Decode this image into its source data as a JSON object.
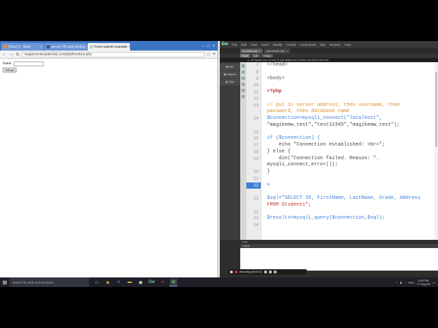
{
  "chrome": {
    "tabs": [
      {
        "label": "(New) 4 - Mem",
        "active": false
      },
      {
        "label": "server FB web hosting",
        "active": false
      },
      {
        "label": "Form submit example",
        "active": true
      }
    ],
    "address": "magicmonkeytutorials.com/php/formtest.php",
    "form": {
      "name_label": "Name:",
      "submit_label": "Submit"
    }
  },
  "dreamweaver": {
    "logo": "Dw",
    "menu": [
      "File",
      "Edit",
      "View",
      "Insert",
      "Modify",
      "Format",
      "Commands",
      "Site",
      "Window",
      "Help"
    ],
    "doc_tabs": [
      {
        "label": "formtest.php",
        "active": true
      },
      {
        "label": "phonebook.php",
        "active": false
      }
    ],
    "view_buttons": [
      {
        "label": "Code",
        "active": true
      },
      {
        "label": "Split",
        "active": false
      },
      {
        "label": "Design",
        "active": false
      }
    ],
    "info_bar": "1/2  Syntax error on line 21 Data testing has not been yet use for the error",
    "left_panels": [
      "Files",
      "Snippets",
      "DOM"
    ],
    "code": [
      {
        "num": "7",
        "text": "</head>",
        "cls": "c-tag"
      },
      {
        "num": "8",
        "text": "",
        "cls": ""
      },
      {
        "num": "9",
        "text": "<body>",
        "cls": "c-tag"
      },
      {
        "num": "10",
        "text": "",
        "cls": ""
      },
      {
        "num": "11",
        "text": "<?php",
        "cls": "c-php"
      },
      {
        "num": "12",
        "text": "",
        "cls": ""
      },
      {
        "num": "13",
        "text": "// put in server address, then username, then",
        "cls": "c-com"
      },
      {
        "num": "",
        "text": "password, then database name",
        "cls": "c-com"
      },
      {
        "num": "14",
        "text": "$connection=mysqli_connect(\"localhost\",",
        "cls": "c-var"
      },
      {
        "num": "",
        "text": "\"magikemw_test\",\"test12345\",\"magikemw_test\");",
        "cls": "c-str"
      },
      {
        "num": "15",
        "text": "",
        "cls": ""
      },
      {
        "num": "16",
        "text": "if ($connection) {",
        "cls": "c-var"
      },
      {
        "num": "17",
        "text": "    echo \"Connection established: <br>\";",
        "cls": "c-str"
      },
      {
        "num": "18",
        "text": "} else {",
        "cls": "c-str"
      },
      {
        "num": "19",
        "text": "    die(\"Connection failed. Reason: \".",
        "cls": "c-str"
      },
      {
        "num": "",
        "text": "mysqli_connect_error());",
        "cls": "c-str"
      },
      {
        "num": "20",
        "text": "}",
        "cls": "c-str"
      },
      {
        "num": "21",
        "text": "",
        "cls": ""
      },
      {
        "num": "22",
        "text": "≡",
        "cls": "c-var",
        "highlight": true
      },
      {
        "num": "",
        "text": "",
        "cls": ""
      },
      {
        "num": "21",
        "text": "$sql=\"SELECT ID, FirstName, LastName, Grade, Address",
        "cls": "c-var"
      },
      {
        "num": "",
        "text": "FROM Students\";",
        "cls": "c-sql"
      },
      {
        "num": "22",
        "text": "",
        "cls": ""
      },
      {
        "num": "23",
        "text": "$results=mysqli_query($connection,$sql);",
        "cls": "c-var"
      },
      {
        "num": "24",
        "text": "",
        "cls": ""
      }
    ],
    "status": "body",
    "output_tab": "Output",
    "recording": "Recording [00:00:07]"
  },
  "taskbar": {
    "search_placeholder": "Search the web and Windows",
    "time": "8:20 PM",
    "date": "17-Aug-16",
    "lang": "ENG"
  }
}
